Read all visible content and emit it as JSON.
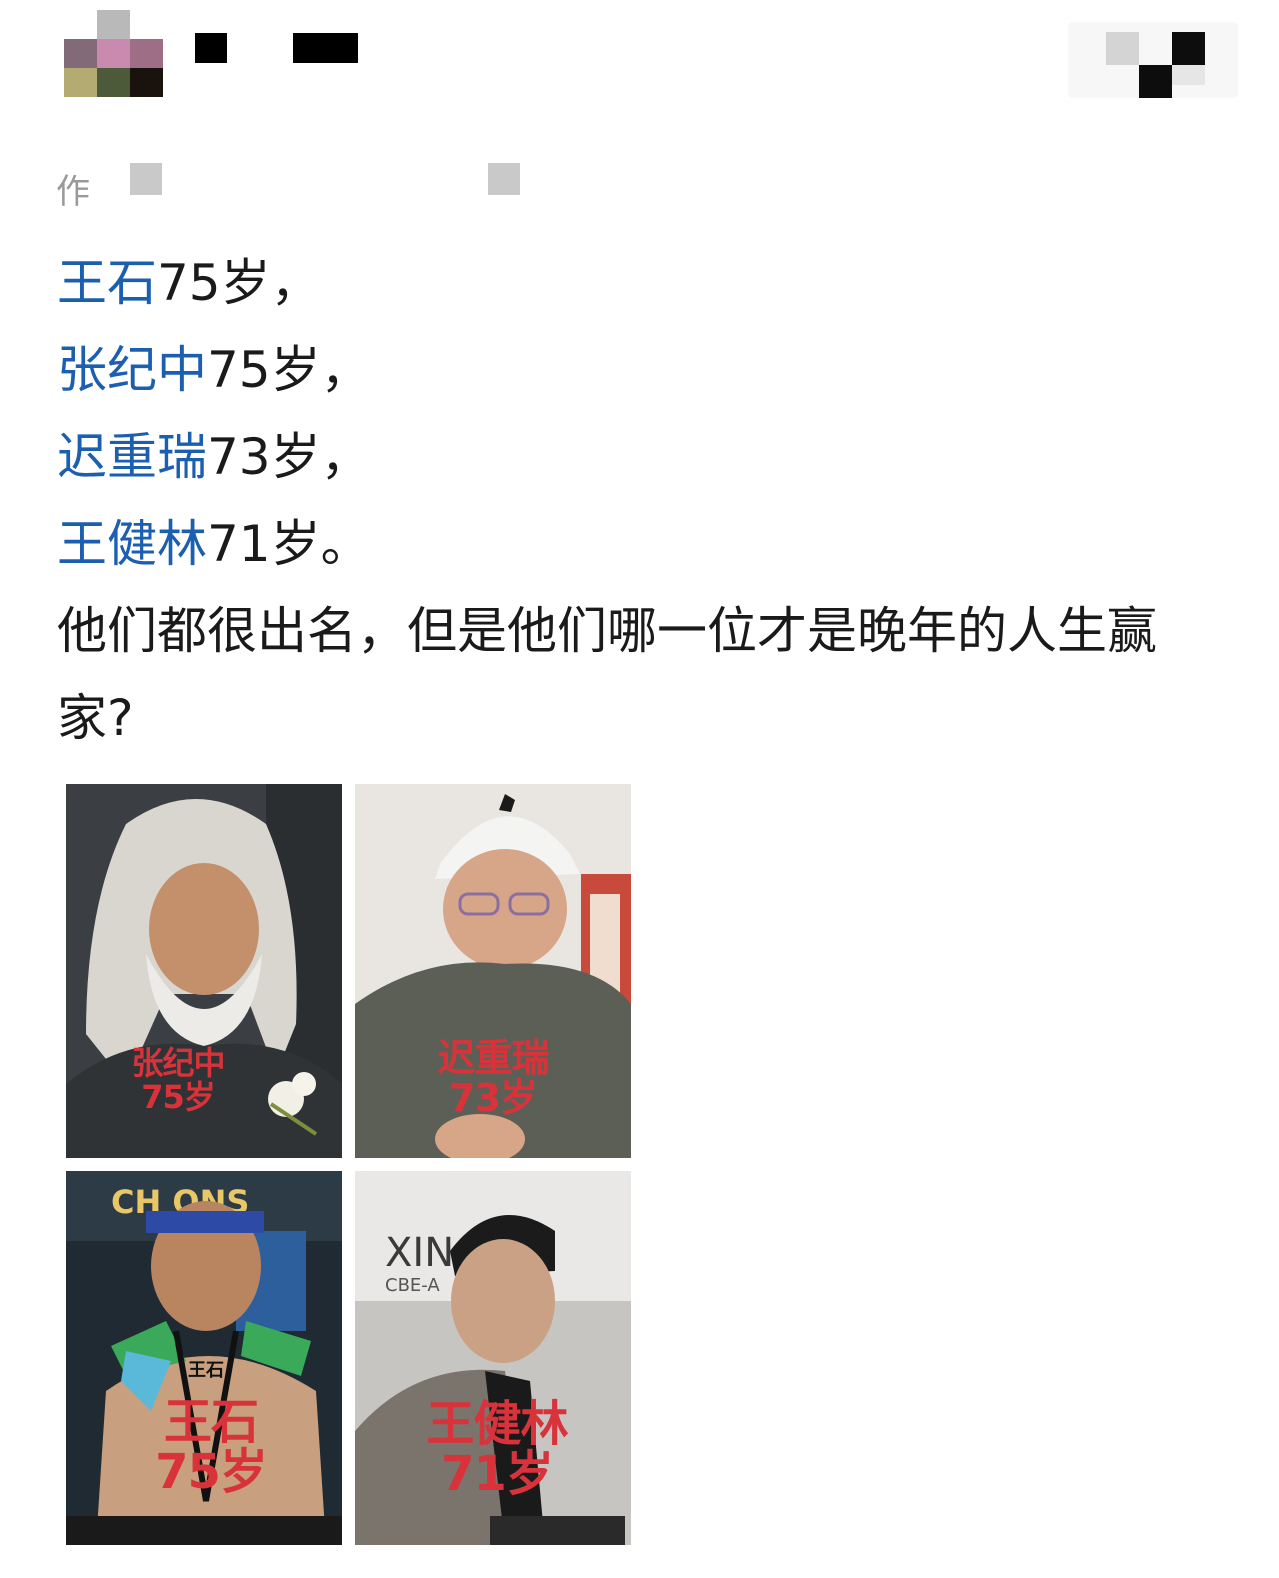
{
  "header": {
    "avatar_colors": [
      "#b9b9b9",
      "#b5b5b5",
      "#ffffff",
      "#826a78",
      "#c98ab0",
      "#9e6e86",
      "#b3ab72",
      "#4d5a3a",
      "#1a120c"
    ],
    "author_prefix": "作"
  },
  "post": {
    "lines": [
      {
        "name": "王石",
        "rest": "75岁，"
      },
      {
        "name": "张纪中",
        "rest": "75岁，"
      },
      {
        "name": "迟重瑞",
        "rest": "73岁，"
      },
      {
        "name": "王健林",
        "rest": "71岁。"
      }
    ],
    "question": "他们都很出名，但是他们哪一位才是晚年的人生赢家?",
    "name_color": "#1c5fb0"
  },
  "photos": [
    {
      "caption_name": "张纪中",
      "caption_age": "75岁"
    },
    {
      "caption_name": "迟重瑞",
      "caption_age": "73岁"
    },
    {
      "caption_name": "王石",
      "caption_age": "75岁",
      "jersey_text": "王石",
      "sign_text": "CH  ONS"
    },
    {
      "caption_name": "王健林",
      "caption_age": "71岁",
      "sign_text": "XIN",
      "sign_sub": "CBE-A"
    }
  ],
  "caption_color": "#d8333a"
}
